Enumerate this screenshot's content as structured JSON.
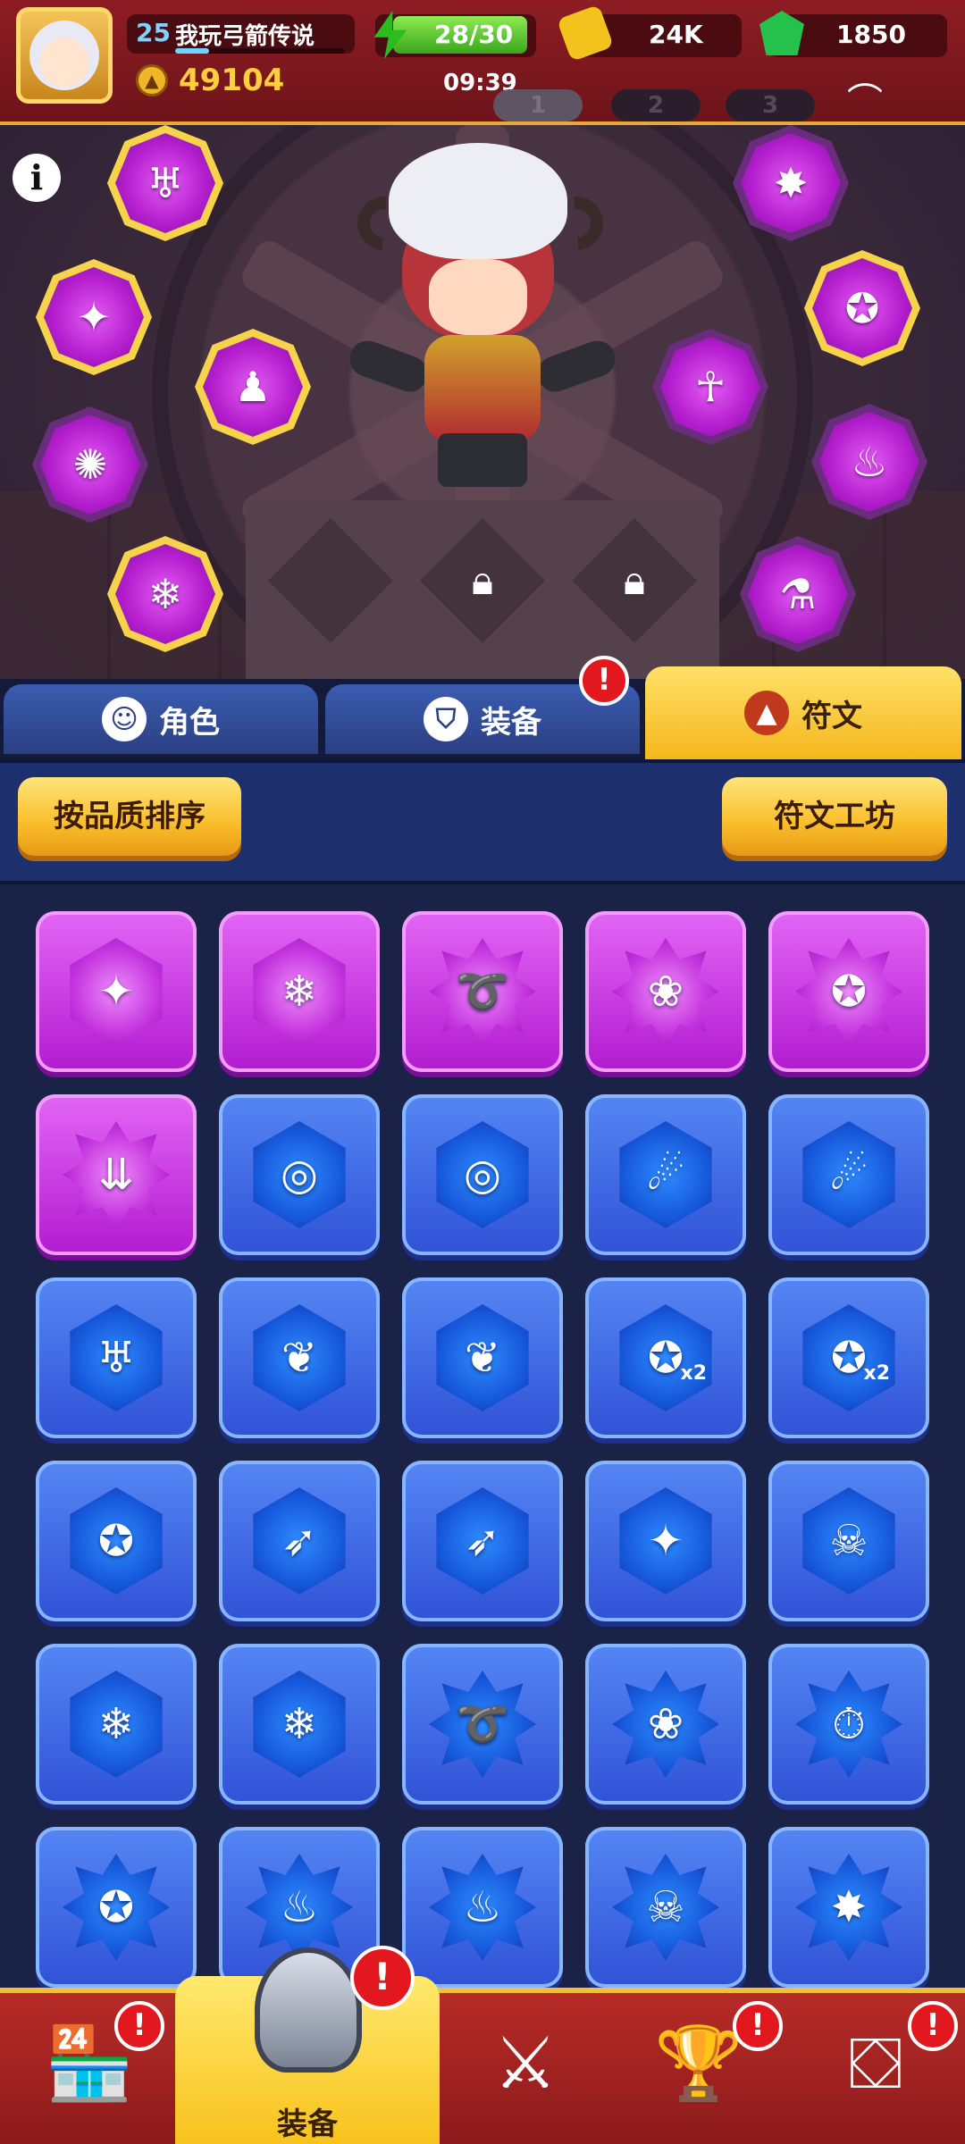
{
  "header": {
    "level": "25",
    "player_name": "我玩弓箭传说",
    "power": "49104",
    "energy": "28/30",
    "gold": "24K",
    "gems": "1850",
    "time": "09:39",
    "page_tabs": [
      "1",
      "2",
      "3"
    ],
    "active_page": "1"
  },
  "info_icon": "i",
  "equipped_slots": [
    {
      "icon": "dragon-rune-icon",
      "glyph": "♅"
    },
    {
      "icon": "claw-shield-rune-icon",
      "glyph": "✦"
    },
    {
      "icon": "ghost-rune-icon",
      "glyph": "♟"
    },
    {
      "icon": "claw-ring-rune-icon",
      "glyph": "✺"
    },
    {
      "icon": "ice-arrow-rune-icon",
      "glyph": "❄"
    },
    {
      "icon": "star-shield-rune-icon",
      "glyph": "✸"
    },
    {
      "icon": "circle-rune-icon",
      "glyph": "✪"
    },
    {
      "icon": "ankh-rune-icon",
      "glyph": "☥"
    },
    {
      "icon": "flame-ring-rune-icon",
      "glyph": "♨"
    },
    {
      "icon": "potion-rune-icon",
      "glyph": "⚗"
    }
  ],
  "tabs": [
    {
      "label": "角色",
      "icon": "character-icon",
      "glyph": "☺"
    },
    {
      "label": "装备",
      "icon": "equipment-icon",
      "glyph": "⛉",
      "badge": "!"
    },
    {
      "label": "符文",
      "icon": "rune-icon",
      "glyph": "▲"
    }
  ],
  "toolbar": {
    "sort_label": "按品质排序",
    "workshop_label": "符文工坊"
  },
  "runes": [
    {
      "rarity": "legend",
      "shape": "hex",
      "icon": "claw-shield-rune-icon",
      "glyph": "✦"
    },
    {
      "rarity": "legend",
      "shape": "hex",
      "icon": "ice-arrow-rune-icon",
      "glyph": "❄"
    },
    {
      "rarity": "legend",
      "shape": "star",
      "icon": "swirl-rune-icon",
      "glyph": "➰"
    },
    {
      "rarity": "legend",
      "shape": "star",
      "icon": "flower-rune-icon",
      "glyph": "❀"
    },
    {
      "rarity": "legend",
      "shape": "star",
      "icon": "blob-rune-icon",
      "glyph": "✪"
    },
    {
      "rarity": "legend",
      "shape": "star",
      "icon": "downward-arrows-rune-icon",
      "glyph": "⇊"
    },
    {
      "rarity": "epic",
      "shape": "hex",
      "icon": "ring-rune-icon",
      "glyph": "◎"
    },
    {
      "rarity": "epic",
      "shape": "hex",
      "icon": "ring-rune-icon",
      "glyph": "◎"
    },
    {
      "rarity": "epic",
      "shape": "hex",
      "icon": "orbit-rune-icon",
      "glyph": "☄"
    },
    {
      "rarity": "epic",
      "shape": "hex",
      "icon": "orbit-rune-icon",
      "glyph": "☄"
    },
    {
      "rarity": "epic",
      "shape": "hex",
      "icon": "dragon-rune-icon",
      "glyph": "♅"
    },
    {
      "rarity": "epic",
      "shape": "hex",
      "icon": "feather-rune-icon",
      "glyph": "❦"
    },
    {
      "rarity": "epic",
      "shape": "hex",
      "icon": "feather-rune-icon",
      "glyph": "❦"
    },
    {
      "rarity": "epic",
      "shape": "hex",
      "icon": "double-blob-rune-icon",
      "glyph": "✪",
      "tag": "x2"
    },
    {
      "rarity": "epic",
      "shape": "hex",
      "icon": "double-blob-rune-icon",
      "glyph": "✪",
      "tag": "x2"
    },
    {
      "rarity": "epic",
      "shape": "hex",
      "icon": "blob-rune-icon",
      "glyph": "✪"
    },
    {
      "rarity": "epic",
      "shape": "hex",
      "icon": "bow-rune-icon",
      "glyph": "➶"
    },
    {
      "rarity": "epic",
      "shape": "hex",
      "icon": "bow-rune-icon",
      "glyph": "➶"
    },
    {
      "rarity": "epic",
      "shape": "hex",
      "icon": "claw-shield-rune-icon",
      "glyph": "✦"
    },
    {
      "rarity": "epic",
      "shape": "hex",
      "icon": "skull-fire-rune-icon",
      "glyph": "☠"
    },
    {
      "rarity": "epic",
      "shape": "hex",
      "icon": "ice-arrow-rune-icon",
      "glyph": "❄"
    },
    {
      "rarity": "epic",
      "shape": "hex",
      "icon": "ice-arrow-rune-icon",
      "glyph": "❄"
    },
    {
      "rarity": "epic",
      "shape": "star",
      "icon": "swirl-rune-icon",
      "glyph": "➰"
    },
    {
      "rarity": "epic",
      "shape": "star",
      "icon": "flower-rune-icon",
      "glyph": "❀"
    },
    {
      "rarity": "epic",
      "shape": "star",
      "icon": "clock-rune-icon",
      "glyph": "⏱"
    },
    {
      "rarity": "epic",
      "shape": "star",
      "icon": "blob-rune-icon",
      "glyph": "✪"
    },
    {
      "rarity": "epic",
      "shape": "star",
      "icon": "flame-ring-rune-icon",
      "glyph": "♨"
    },
    {
      "rarity": "epic",
      "shape": "star",
      "icon": "flame-ring-rune-icon",
      "glyph": "♨"
    },
    {
      "rarity": "epic",
      "shape": "star",
      "icon": "skull-fire-rune-icon",
      "glyph": "☠"
    },
    {
      "rarity": "epic",
      "shape": "star",
      "icon": "star-shield-rune-icon",
      "glyph": "✸"
    }
  ],
  "bottom_nav": [
    {
      "name": "shop",
      "icon": "shop-icon",
      "glyph": "🏪",
      "badge": "!"
    },
    {
      "name": "equipment",
      "icon": "helmet-icon",
      "label": "装备",
      "badge": "!"
    },
    {
      "name": "battle",
      "icon": "sword-shield-icon",
      "glyph": "⚔"
    },
    {
      "name": "trophy",
      "icon": "trophy-icon",
      "glyph": "🏆",
      "badge": "!"
    },
    {
      "name": "puzzle",
      "icon": "puzzle-board-icon",
      "glyph": "⛋",
      "badge": "!"
    }
  ],
  "colors": {
    "header_red": "#8e1d24",
    "legend_purple": "#b21bd0",
    "epic_blue": "#3052d6",
    "button_yellow": "#f9bd2a",
    "badge_red": "#e3171e"
  }
}
